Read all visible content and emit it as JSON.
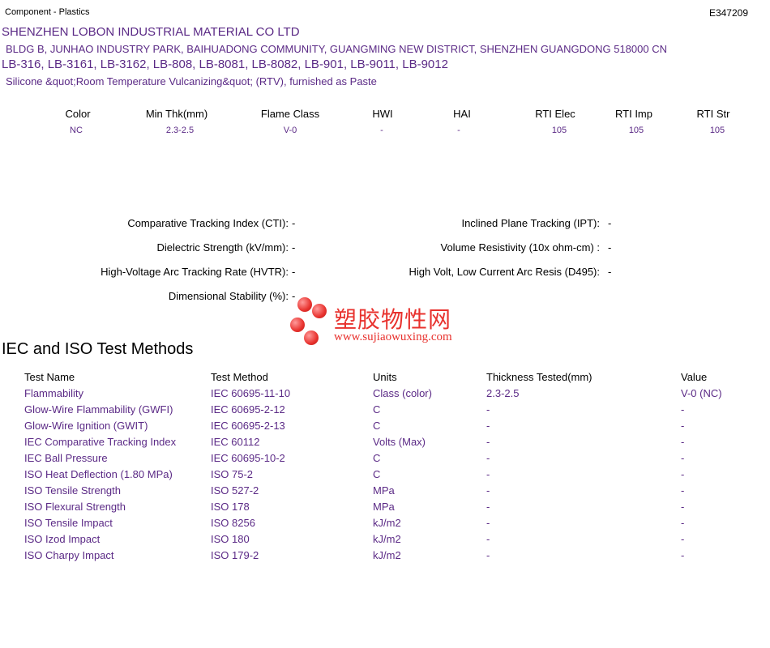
{
  "header": {
    "component": "Component - Plastics",
    "file_number": "E347209"
  },
  "company": {
    "name": "SHENZHEN LOBON INDUSTRIAL MATERIAL CO LTD",
    "address": "BLDG B, JUNHAO INDUSTRY PARK, BAIHUADONG COMMUNITY, GUANGMING NEW DISTRICT, SHENZHEN  GUANGDONG  518000 CN"
  },
  "models": "LB-316, LB-3161, LB-3162, LB-808, LB-8081, LB-8082, LB-901, LB-9011, LB-9012",
  "description": "Silicone &quot;Room Temperature Vulcanizing&quot; (RTV), furnished as Paste",
  "ratings": {
    "headers": [
      "Color",
      "Min Thk(mm)",
      "Flame Class",
      "HWI",
      "HAI",
      "RTI Elec",
      "RTI Imp",
      "RTI Str"
    ],
    "values": [
      "NC",
      "2.3-2.5",
      "V-0",
      "-",
      "-",
      "105",
      "105",
      "105"
    ]
  },
  "properties": {
    "left": [
      {
        "label": "Comparative Tracking Index (CTI):",
        "value": "-"
      },
      {
        "label": "Dielectric Strength (kV/mm):",
        "value": "-"
      },
      {
        "label": "High-Voltage Arc Tracking Rate (HVTR):",
        "value": "-"
      },
      {
        "label": "Dimensional Stability (%):",
        "value": "-"
      }
    ],
    "right": [
      {
        "label": "Inclined Plane Tracking (IPT):",
        "value": "-"
      },
      {
        "label": "Volume Resistivity (10x ohm-cm) :",
        "value": "-"
      },
      {
        "label": "High Volt, Low Current Arc Resis (D495):",
        "value": "-"
      }
    ]
  },
  "watermark": {
    "chinese": "塑胶物性网",
    "url": "www.sujiaowuxing.com"
  },
  "test_methods": {
    "title": "IEC and ISO Test Methods",
    "columns": [
      "Test Name",
      "Test Method",
      "Units",
      "Thickness Tested(mm)",
      "Value"
    ],
    "rows": [
      [
        "Flammability",
        "IEC 60695-11-10",
        "Class (color)",
        "2.3-2.5",
        "V-0 (NC)"
      ],
      [
        "Glow-Wire Flammability (GWFI)",
        "IEC 60695-2-12",
        "C",
        "-",
        "-"
      ],
      [
        "Glow-Wire Ignition (GWIT)",
        "IEC 60695-2-13",
        "C",
        "-",
        "-"
      ],
      [
        "IEC Comparative Tracking Index",
        "IEC 60112",
        "Volts (Max)",
        "-",
        "-"
      ],
      [
        "IEC Ball Pressure",
        "IEC 60695-10-2",
        "C",
        "-",
        "-"
      ],
      [
        "ISO Heat Deflection (1.80 MPa)",
        "ISO 75-2",
        "C",
        "-",
        "-"
      ],
      [
        "ISO Tensile Strength",
        "ISO 527-2",
        "MPa",
        "-",
        "-"
      ],
      [
        "ISO Flexural Strength",
        "ISO 178",
        "MPa",
        "-",
        "-"
      ],
      [
        "ISO Tensile Impact",
        "ISO 8256",
        "kJ/m2",
        "-",
        "-"
      ],
      [
        "ISO Izod Impact",
        "ISO 180",
        "kJ/m2",
        "-",
        "-"
      ],
      [
        "ISO Charpy Impact",
        "ISO 179-2",
        "kJ/m2",
        "-",
        "-"
      ]
    ]
  },
  "colors": {
    "text": "#000000",
    "accent": "#5b2a86",
    "watermark": "#e8322e"
  }
}
